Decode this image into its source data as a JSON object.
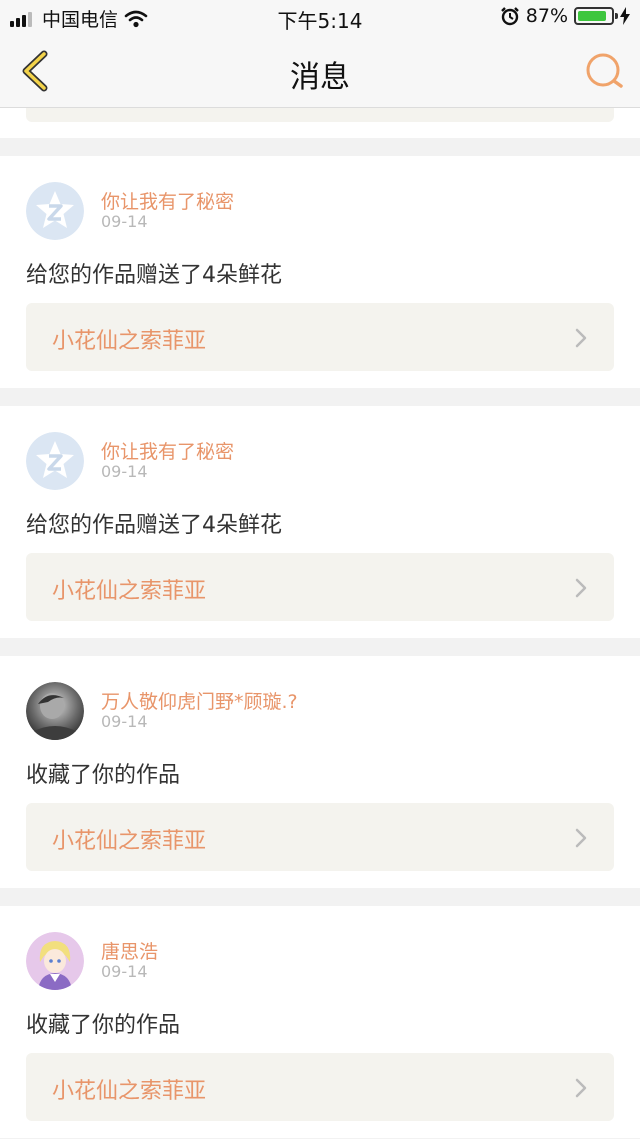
{
  "status_bar": {
    "carrier": "中国电信",
    "time": "下午5:14",
    "battery_percent": "87%",
    "battery_level": 0.87
  },
  "nav": {
    "title": "消息",
    "back_icon": "chevron-left-icon",
    "search_icon": "search-icon",
    "accent_color": "#e8956a"
  },
  "messages": [
    {
      "user": "你让我有了秘密",
      "date": "09-14",
      "action": "给您的作品赠送了4朵鲜花",
      "work": "小花仙之索菲亚",
      "avatar": "qq-default-avatar"
    },
    {
      "user": "你让我有了秘密",
      "date": "09-14",
      "action": "给您的作品赠送了4朵鲜花",
      "work": "小花仙之索菲亚",
      "avatar": "qq-default-avatar"
    },
    {
      "user": "万人敬仰虎门野*顾璇.?",
      "date": "09-14",
      "action": "收藏了你的作品",
      "work": "小花仙之索菲亚",
      "avatar": "photo-avatar"
    },
    {
      "user": "唐思浩",
      "date": "09-14",
      "action": "收藏了你的作品",
      "work": "小花仙之索菲亚",
      "avatar": "anime-avatar"
    }
  ]
}
